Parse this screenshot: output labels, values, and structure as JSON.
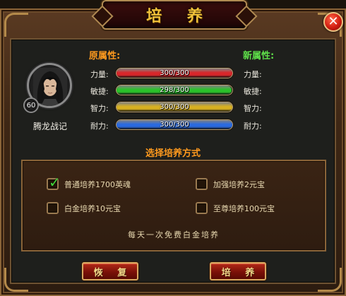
{
  "window": {
    "title": "培 养"
  },
  "hero": {
    "name": "腾龙战记",
    "level": "60"
  },
  "attributes": {
    "old_title": "原属性:",
    "new_title": "新属性:",
    "rows": [
      {
        "label": "力量:",
        "value_text": "300/300",
        "fill": 1.0,
        "color": "#d8262a",
        "new_label": "力量:"
      },
      {
        "label": "敏捷:",
        "value_text": "298/300",
        "fill": 0.993,
        "color": "#2ac22a",
        "new_label": "敏捷:"
      },
      {
        "label": "智力:",
        "value_text": "300/300",
        "fill": 1.0,
        "color": "#d8b020",
        "new_label": "智力:"
      },
      {
        "label": "耐力:",
        "value_text": "300/300",
        "fill": 1.0,
        "color": "#2a6ae0",
        "new_label": "耐力:"
      }
    ]
  },
  "training": {
    "title": "选择培养方式",
    "options": [
      {
        "label": "普通培养1700英魂",
        "checked": true
      },
      {
        "label": "加强培养2元宝",
        "checked": false
      },
      {
        "label": "白金培养10元宝",
        "checked": false
      },
      {
        "label": "至尊培养100元宝",
        "checked": false
      }
    ],
    "tip": "每天一次免费白金培养"
  },
  "buttons": {
    "restore": "恢 复",
    "train": "培 养"
  },
  "colors": {
    "accent_orange": "#ff9a1e",
    "accent_green": "#5fe04a",
    "title_gold": "#f0c23a",
    "button_red": "#9a1a0c"
  }
}
